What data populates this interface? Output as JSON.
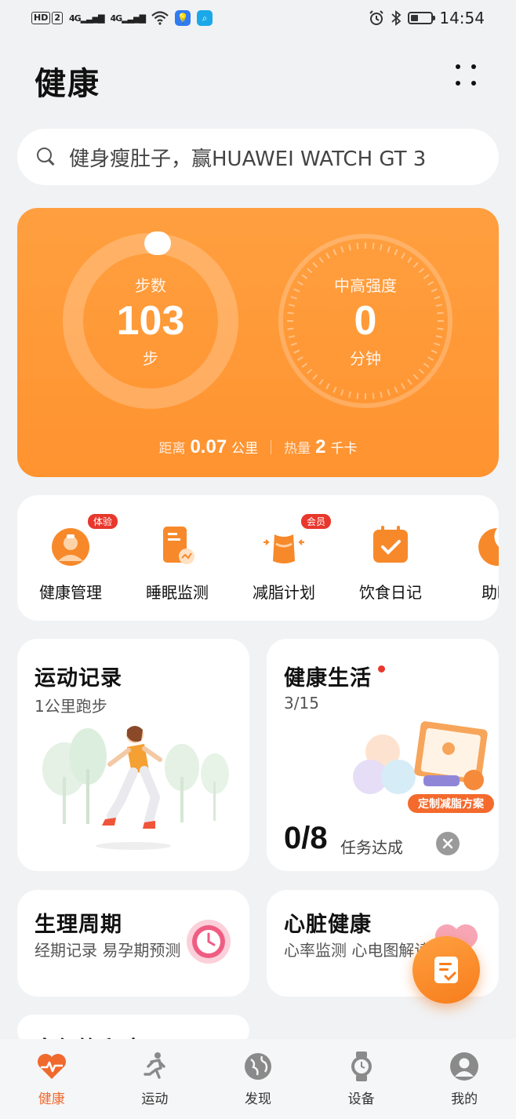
{
  "status_bar": {
    "hd": "HD",
    "sim": "2",
    "net1": "4G",
    "net2": "4G",
    "time": "14:54"
  },
  "header": {
    "title": "健康"
  },
  "search": {
    "placeholder": "健身瘦肚子，赢HUAWEI WATCH GT 3"
  },
  "activity": {
    "steps_label": "步数",
    "steps_value": "103",
    "steps_unit": "步",
    "intensity_label": "中高强度",
    "intensity_value": "0",
    "intensity_unit": "分钟",
    "distance_label": "距离",
    "distance_value": "0.07",
    "distance_unit": "公里",
    "calories_label": "热量",
    "calories_value": "2",
    "calories_unit": "千卡"
  },
  "services": [
    {
      "label": "健康管理",
      "badge": "体验",
      "icon": "health-management-icon"
    },
    {
      "label": "睡眠监测",
      "badge": "",
      "icon": "sleep-monitor-icon"
    },
    {
      "label": "减脂计划",
      "badge": "会员",
      "icon": "fat-loss-icon"
    },
    {
      "label": "饮食日记",
      "badge": "",
      "icon": "diet-diary-icon"
    },
    {
      "label": "助眠",
      "badge": "",
      "icon": "sleep-aid-icon"
    }
  ],
  "cards": {
    "exercise": {
      "title": "运动记录",
      "subtitle": "1公里跑步"
    },
    "healthy_life": {
      "title": "健康生活",
      "progress": "3/15",
      "tasks_value": "0/8",
      "tasks_label": "任务达成",
      "banner": "定制减脂方案"
    },
    "cycle": {
      "title": "生理周期",
      "subtitle": "经期记录 易孕期预测"
    },
    "heart": {
      "title": "心脏健康",
      "subtitle": "心率监测 心电图解读"
    },
    "partial": {
      "title": "血氧饱和度"
    }
  },
  "nav": [
    {
      "label": "健康",
      "icon": "heart-pulse-icon",
      "active": true
    },
    {
      "label": "运动",
      "icon": "running-icon",
      "active": false
    },
    {
      "label": "发现",
      "icon": "discover-globe-icon",
      "active": false
    },
    {
      "label": "设备",
      "icon": "watch-icon",
      "active": false
    },
    {
      "label": "我的",
      "icon": "profile-icon",
      "active": false
    }
  ],
  "colors": {
    "accent": "#ff9a38",
    "active_nav": "#f06a2e",
    "badge": "#e8372c"
  }
}
